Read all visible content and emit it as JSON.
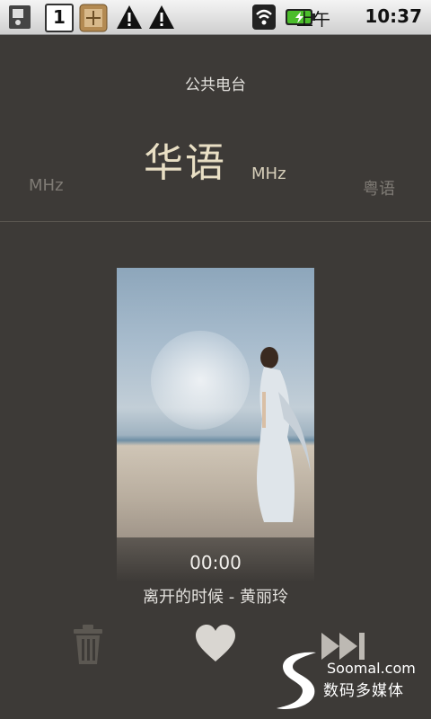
{
  "status_bar": {
    "ampm": "上午",
    "time": "10:37",
    "notification_icons": [
      "sd-card-icon",
      "calendar-icon",
      "app-icon",
      "warning-icon",
      "warning-icon"
    ],
    "calendar_day": "1",
    "right_icons": [
      "wifi-icon",
      "battery-charging-icon"
    ]
  },
  "header": {
    "category": "公共电台"
  },
  "stations": {
    "current": "华语",
    "current_unit": "MHz",
    "previous": "MHz",
    "next": "粤语"
  },
  "player": {
    "elapsed": "00:00",
    "track": "离开的时候 - 黄丽玲"
  },
  "controls": {
    "delete_icon": "trash-icon",
    "favorite_icon": "heart-icon",
    "next_icon": "skip-next-icon"
  },
  "watermark": {
    "site": "Soomal.com",
    "subtitle": "数码多媒体"
  },
  "colors": {
    "background": "#3d3a37",
    "accent_title": "#e9dfc4",
    "dim_text": "#7f7b75"
  }
}
